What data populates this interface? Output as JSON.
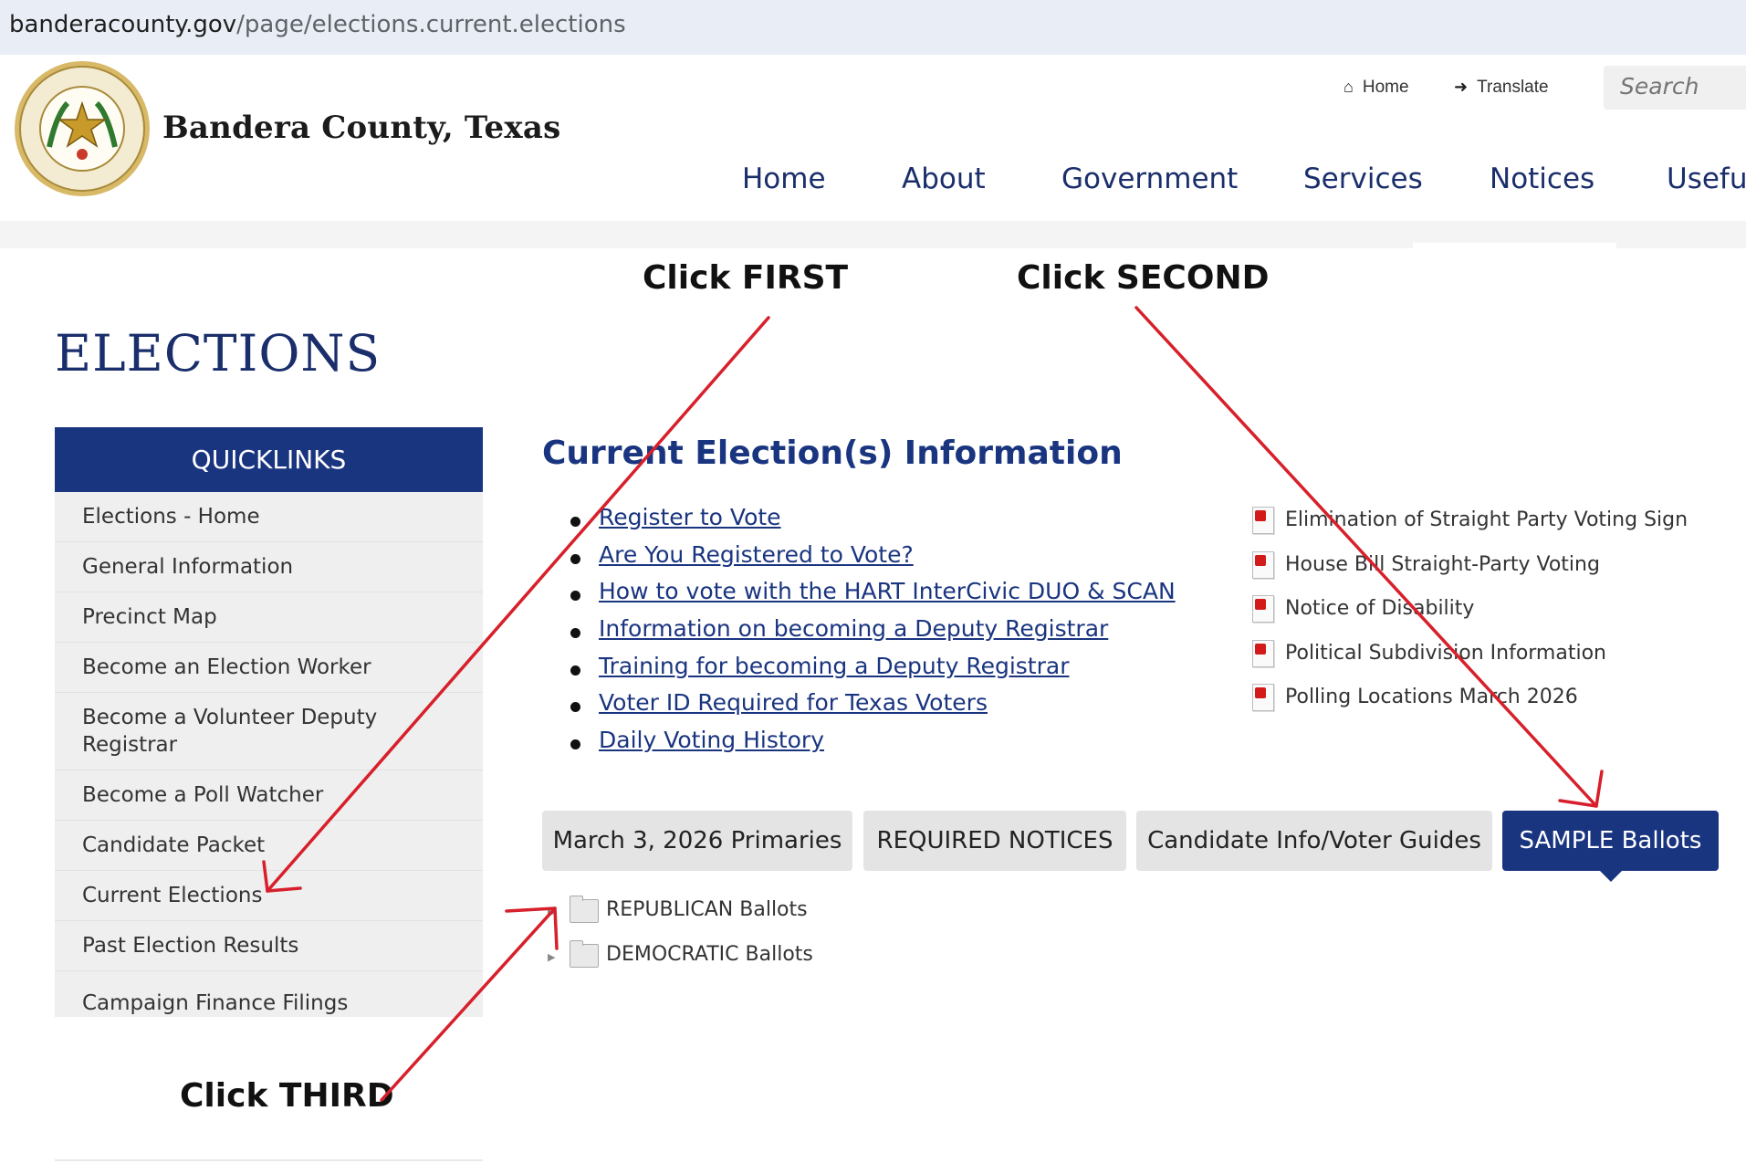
{
  "browser": {
    "url_domain": "banderacounty.gov",
    "url_path": "/page/elections.current.elections"
  },
  "header": {
    "site_name": "Bandera County, Texas",
    "utility": {
      "home": "Home",
      "translate": "Translate"
    },
    "search_placeholder": "Search",
    "nav": [
      "Home",
      "About",
      "Government",
      "Services",
      "Notices",
      "Useful"
    ]
  },
  "page": {
    "title": "ELECTIONS"
  },
  "quicklinks": {
    "title": "QUICKLINKS",
    "items": [
      "Elections - Home",
      "General Information",
      "Precinct Map",
      "Become an Election Worker",
      "Become a Volunteer Deputy Registrar",
      "Become a Poll Watcher",
      "Candidate Packet",
      "Current Elections",
      "Past Election Results",
      "Campaign Finance Filings"
    ]
  },
  "main": {
    "heading": "Current Election(s) Information",
    "links": [
      "Register to Vote",
      "Are You Registered to Vote?",
      "How to vote with the HART InterCivic DUO & SCAN",
      "Information on becoming a Deputy Registrar",
      "Training for becoming a Deputy Registrar",
      "Voter ID Required for Texas Voters",
      "Daily Voting History"
    ],
    "documents": [
      "Elimination of Straight Party Voting Sign",
      "House Bill Straight-Party Voting",
      "Notice of Disability",
      "Political Subdivision Information",
      "Polling Locations March 2026"
    ],
    "tabs": [
      {
        "label": "March 3, 2026 Primaries",
        "active": false
      },
      {
        "label": "REQUIRED NOTICES",
        "active": false
      },
      {
        "label": "Candidate Info/Voter Guides",
        "active": false
      },
      {
        "label": "SAMPLE Ballots",
        "active": true
      }
    ],
    "folders": [
      "REPUBLICAN Ballots",
      "DEMOCRATIC Ballots"
    ]
  },
  "annotations": {
    "first": "Click FIRST",
    "second": "Click SECOND",
    "third": "Click THIRD"
  },
  "colors": {
    "brand_navy": "#1a3580",
    "arrow_red": "#d7202b"
  }
}
